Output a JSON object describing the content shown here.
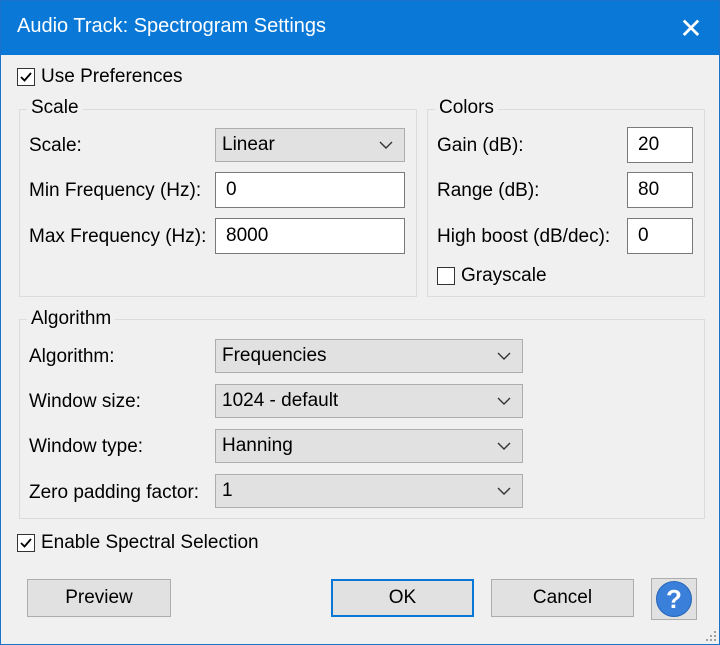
{
  "window": {
    "title": "Audio Track: Spectrogram Settings",
    "close_glyph": "✕"
  },
  "use_preferences": {
    "label": "Use Preferences",
    "checked": true
  },
  "scale_group": {
    "title": "Scale",
    "scale_label": "Scale:",
    "scale_value": "Linear",
    "min_freq_label": "Min Frequency (Hz):",
    "min_freq_value": "0",
    "max_freq_label": "Max Frequency (Hz):",
    "max_freq_value": "8000"
  },
  "colors_group": {
    "title": "Colors",
    "gain_label": "Gain (dB):",
    "gain_value": "20",
    "range_label": "Range (dB):",
    "range_value": "80",
    "high_boost_label": "High boost (dB/dec):",
    "high_boost_value": "0",
    "grayscale_label": "Grayscale",
    "grayscale_checked": false
  },
  "algorithm_group": {
    "title": "Algorithm",
    "algorithm_label": "Algorithm:",
    "algorithm_value": "Frequencies",
    "window_size_label": "Window size:",
    "window_size_value": "1024 - default",
    "window_type_label": "Window type:",
    "window_type_value": "Hanning",
    "zero_padding_label": "Zero padding factor:",
    "zero_padding_value": "1"
  },
  "spectral_selection": {
    "label": "Enable Spectral Selection",
    "checked": true
  },
  "buttons": {
    "preview": "Preview",
    "ok": "OK",
    "cancel": "Cancel",
    "help": "?"
  },
  "colors": {
    "titlebar": "#0a78d7",
    "accent": "#0a78d7",
    "help_icon": "#3a7fd9"
  },
  "icons": {
    "check": "check-icon",
    "dropdown": "chevron-down-icon",
    "help": "help-icon",
    "grip": "resize-grip-icon"
  }
}
